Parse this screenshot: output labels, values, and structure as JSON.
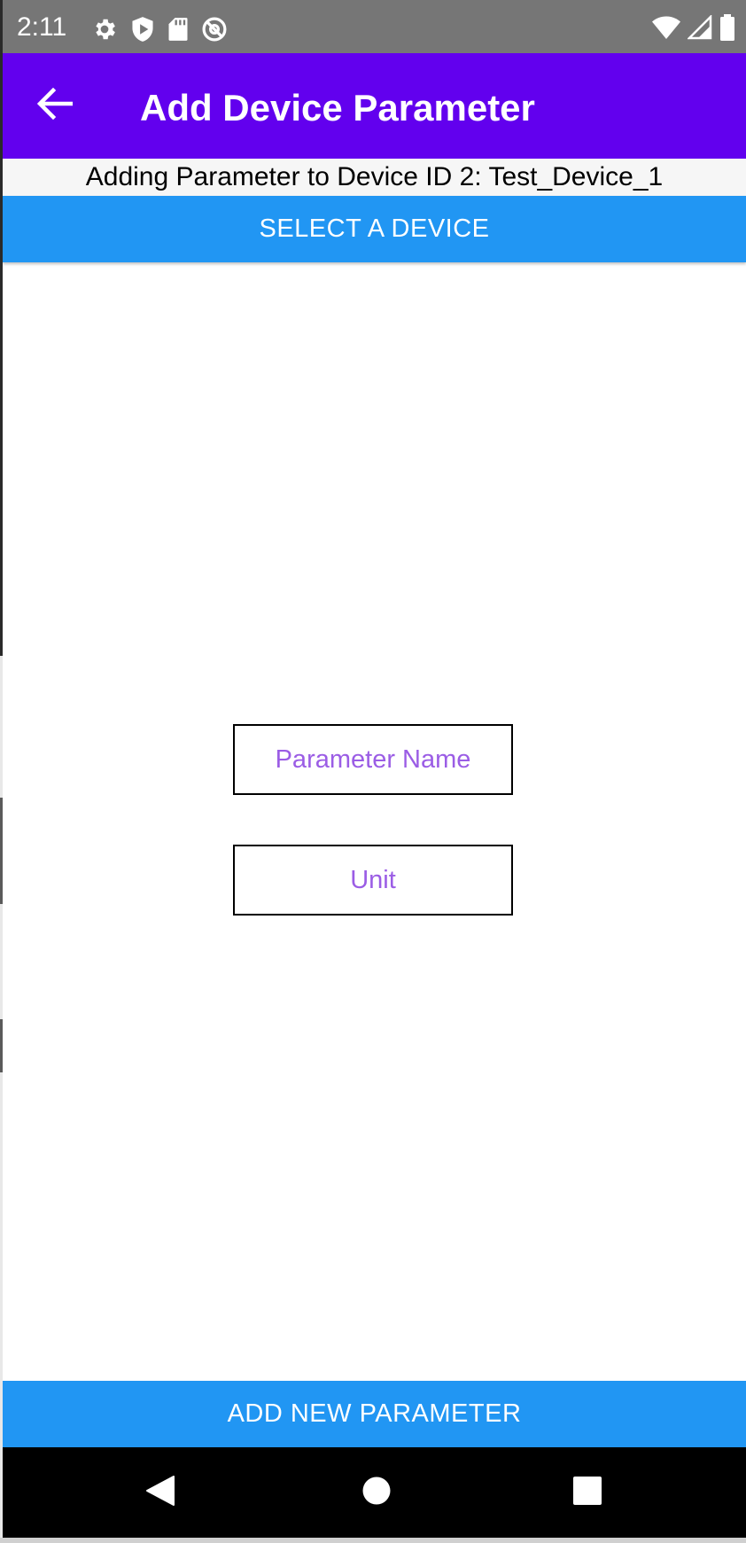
{
  "status_bar": {
    "time": "2:11",
    "left_icons": [
      "settings-icon",
      "shield-play-icon",
      "sd-card-icon",
      "at-sign-icon"
    ],
    "right_icons": [
      "wifi-icon",
      "cell-signal-icon",
      "battery-icon"
    ]
  },
  "app_bar": {
    "title": "Add Device Parameter",
    "back_icon": "back-arrow-icon",
    "color": "#6200ee"
  },
  "info": {
    "text": "Adding Parameter to Device ID 2: Test_Device_1"
  },
  "buttons": {
    "select_device": "SELECT A DEVICE",
    "add_parameter": "ADD NEW PARAMETER",
    "color": "#2196f3"
  },
  "form": {
    "parameter_name": {
      "value": "",
      "placeholder": "Parameter Name"
    },
    "unit": {
      "value": "",
      "placeholder": "Unit"
    },
    "placeholder_color": "#9b5de5"
  },
  "nav_bar": {
    "icons": [
      "nav-back-icon",
      "nav-home-icon",
      "nav-recents-icon"
    ]
  }
}
